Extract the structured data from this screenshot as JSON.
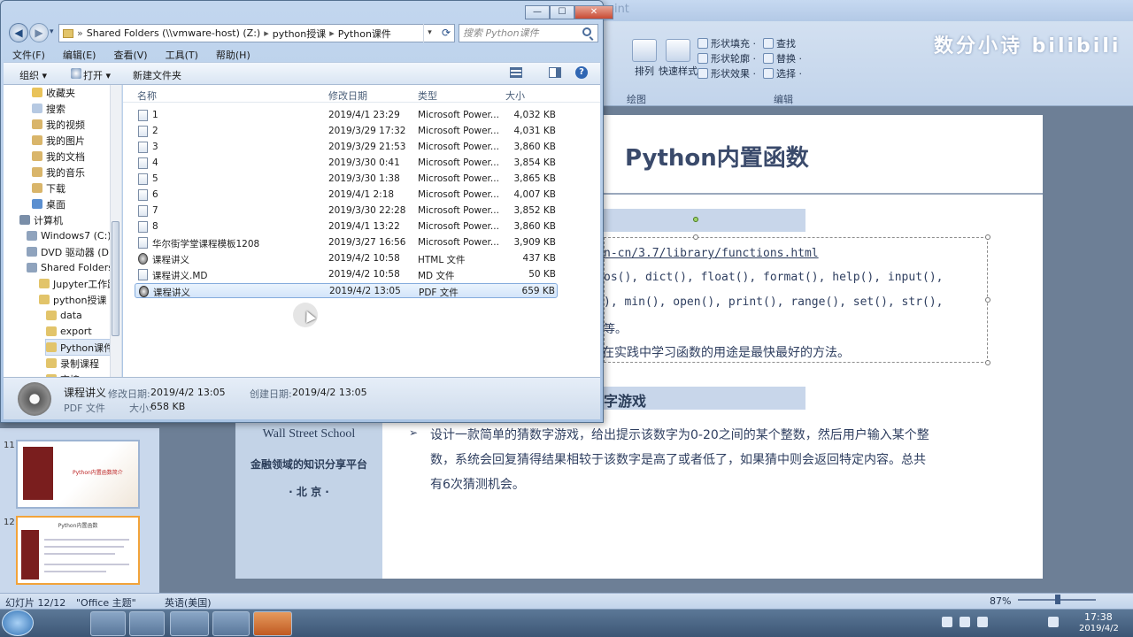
{
  "ppt": {
    "title_fragment": "oint",
    "watermark": "数分小诗 bilibili",
    "ribbon": {
      "arrange": "排列",
      "quick_styles": "快速样式",
      "shape_fill": "形状填充 ·",
      "shape_outline": "形状轮廓 ·",
      "shape_effects": "形状效果 ·",
      "find": "查找",
      "replace": "替换 ·",
      "select": "选择 ·",
      "group_drawing": "绘图",
      "group_editing": "编辑"
    },
    "slide_numbers": [
      "11",
      "12"
    ],
    "thumb1_title": "Python内置函数简介",
    "thumb2_title": "Python内置函数",
    "slide": {
      "title": "Python内置函数",
      "url": "n-cn/3.7/library/functions.html",
      "code_line_1": "os(), dict(), float(), format(), help(), input(),",
      "code_line_2": "), min(), open(), print(), range(), set(), str(),",
      "line_4": "等。",
      "line_5": "在实践中学习函数的用途是最快最好的方法。",
      "section2_title": "字游戏",
      "bullet": "➢",
      "para_line_1": "设计一款简单的猜数字游戏，给出提示该数字为0-20之间的某个整数，然后用户输入某个整",
      "para_line_2": "数，系统会回复猜得结果相较于该数字是高了或者低了，如果猜中则会返回特定内容。总共",
      "para_line_3": "有6次猜测机会。"
    },
    "left_panel": {
      "school": "Wall Street School",
      "tagline": "金融领域的知识分享平台",
      "city": "· 北 京 ·"
    },
    "status": {
      "slide_count": "幻灯片 12/12",
      "theme": "\"Office 主题\"",
      "language": "英语(美国)",
      "zoom": "87%"
    }
  },
  "taskbar": {
    "time": "17:38",
    "date": "2019/4/2"
  },
  "explorer": {
    "window_controls": [
      "—",
      "☐",
      "✕"
    ],
    "address": {
      "segments": [
        "Shared Folders (\\\\vmware-host) (Z:)",
        "python授课",
        "Python课件"
      ]
    },
    "search_placeholder": "搜索 Python课件",
    "menu": [
      "文件(F)",
      "编辑(E)",
      "查看(V)",
      "工具(T)",
      "帮助(H)"
    ],
    "toolbar": {
      "organize": "组织 ▾",
      "open": "打开 ▾",
      "new_folder": "新建文件夹"
    },
    "nav": [
      {
        "label": "收藏夹",
        "color": "#e9c35a"
      },
      {
        "label": "搜索",
        "color": "#b6c9e2"
      },
      {
        "label": "我的视频",
        "color": "#d9b56a"
      },
      {
        "label": "我的图片",
        "color": "#d9b56a"
      },
      {
        "label": "我的文档",
        "color": "#d9b56a"
      },
      {
        "label": "我的音乐",
        "color": "#d9b56a"
      },
      {
        "label": "下载",
        "color": "#d9b56a"
      },
      {
        "label": "桌面",
        "color": "#5b8fd0"
      },
      {
        "label": "计算机",
        "color": "#7a8ea8"
      },
      {
        "label": "Windows7 (C:)",
        "color": "#8fa3bd"
      },
      {
        "label": "DVD 驱动器 (D:",
        "color": "#8fa3bd"
      },
      {
        "label": "Shared Folders",
        "color": "#8fa3bd"
      },
      {
        "label": "Jupyter工作路",
        "color": "#e2c46a"
      },
      {
        "label": "python授课",
        "color": "#e2c46a"
      },
      {
        "label": "data",
        "color": "#e2c46a"
      },
      {
        "label": "export",
        "color": "#e2c46a"
      },
      {
        "label": "Python课件",
        "color": "#e2c46a"
      },
      {
        "label": "录制课程",
        "color": "#e2c46a"
      },
      {
        "label": "交接",
        "color": "#e2c46a"
      }
    ],
    "columns": {
      "name": "名称",
      "modified": "修改日期",
      "type": "类型",
      "size": "大小"
    },
    "files": [
      {
        "name": "1",
        "date": "2019/4/1 23:29",
        "type": "Microsoft Power...",
        "size": "4,032 KB"
      },
      {
        "name": "2",
        "date": "2019/3/29 17:32",
        "type": "Microsoft Power...",
        "size": "4,031 KB"
      },
      {
        "name": "3",
        "date": "2019/3/29 21:53",
        "type": "Microsoft Power...",
        "size": "3,860 KB"
      },
      {
        "name": "4",
        "date": "2019/3/30 0:41",
        "type": "Microsoft Power...",
        "size": "3,854 KB"
      },
      {
        "name": "5",
        "date": "2019/3/30 1:38",
        "type": "Microsoft Power...",
        "size": "3,865 KB"
      },
      {
        "name": "6",
        "date": "2019/4/1 2:18",
        "type": "Microsoft Power...",
        "size": "4,007 KB"
      },
      {
        "name": "7",
        "date": "2019/3/30 22:28",
        "type": "Microsoft Power...",
        "size": "3,852 KB"
      },
      {
        "name": "8",
        "date": "2019/4/1 13:22",
        "type": "Microsoft Power...",
        "size": "3,860 KB"
      },
      {
        "name": "华尔街学堂课程模板1208",
        "date": "2019/3/27 16:56",
        "type": "Microsoft Power...",
        "size": "3,909 KB"
      },
      {
        "name": "课程讲义",
        "date": "2019/4/2 10:58",
        "type": "HTML 文件",
        "size": "437 KB"
      },
      {
        "name": "课程讲义.MD",
        "date": "2019/4/2 10:58",
        "type": "MD 文件",
        "size": "50 KB"
      },
      {
        "name": "课程讲义",
        "date": "2019/4/2 13:05",
        "type": "PDF 文件",
        "size": "659 KB"
      }
    ],
    "details": {
      "name": "课程讲义",
      "modified_label": "修改日期:",
      "modified_value": "2019/4/2 13:05",
      "created_label": "创建日期:",
      "created_value": "2019/4/2 13:05",
      "type": "PDF 文件",
      "size_label": "大小:",
      "size_value": "658 KB"
    }
  }
}
